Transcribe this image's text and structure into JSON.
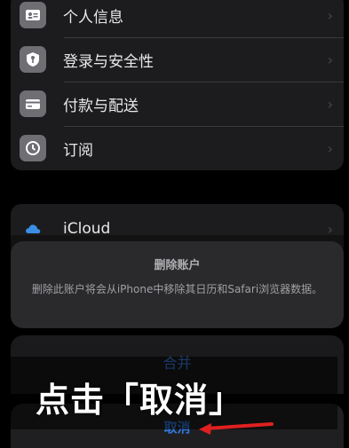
{
  "settings": {
    "items": [
      {
        "label": "个人信息",
        "icon": "person-card-icon"
      },
      {
        "label": "登录与安全性",
        "icon": "key-shield-icon"
      },
      {
        "label": "付款与配送",
        "icon": "credit-card-icon"
      },
      {
        "label": "订阅",
        "icon": "subscription-icon"
      }
    ],
    "icloud": {
      "label": "iCloud",
      "icon": "icloud-icon"
    },
    "chevron": "›"
  },
  "action_sheet": {
    "title": "删除账户",
    "message": "删除此账户将会从iPhone中移除其日历和Safari浏览器数据。",
    "merge_label": "合并",
    "cancel_label": "取消"
  },
  "overlay": {
    "caption": "点击「取消」",
    "arrow_color": "#e02020"
  },
  "colors": {
    "accent": "#2f78dd",
    "background": "#000000",
    "group": "#1c1c1e"
  }
}
